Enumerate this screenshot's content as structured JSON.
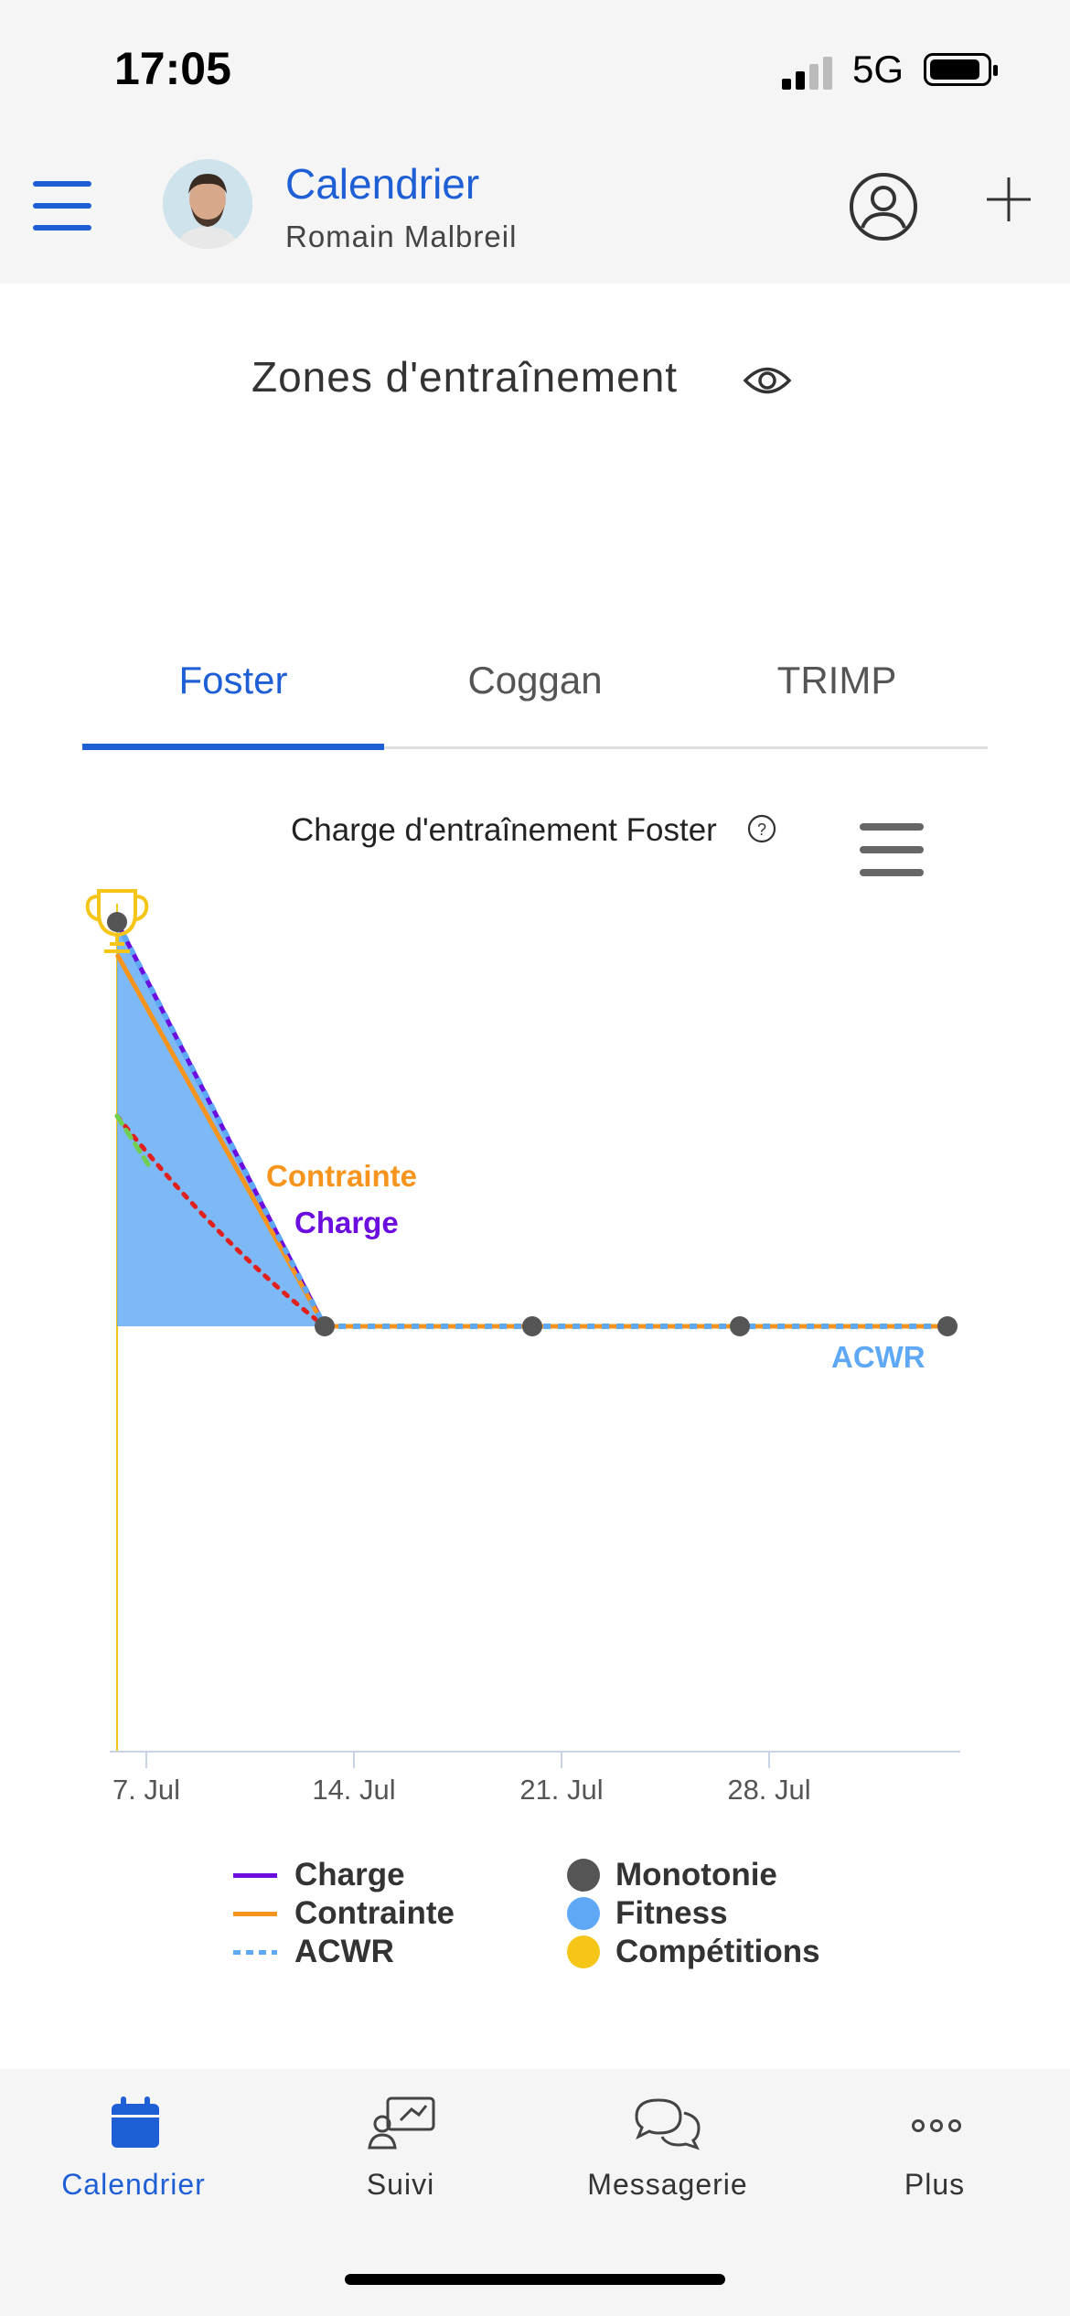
{
  "status": {
    "time": "17:05",
    "network": "5G"
  },
  "header": {
    "title": "Calendrier",
    "subtitle": "Romain Malbreil"
  },
  "section": {
    "title": "Zones d'entraînement"
  },
  "tabs": [
    {
      "label": "Foster",
      "active": true
    },
    {
      "label": "Coggan",
      "active": false
    },
    {
      "label": "TRIMP",
      "active": false
    }
  ],
  "chart": {
    "title": "Charge d'entraînement Foster",
    "labels": {
      "contrainte": "Contrainte",
      "charge": "Charge",
      "acwr": "ACWR"
    },
    "legend": {
      "charge": "Charge",
      "contrainte": "Contrainte",
      "acwr": "ACWR",
      "monotonie": "Monotonie",
      "fitness": "Fitness",
      "competitions": "Compétitions"
    }
  },
  "chart_data": {
    "type": "line",
    "x_ticks": [
      "7. Jul",
      "14. Jul",
      "21. Jul",
      "28. Jul"
    ],
    "series": [
      {
        "name": "Charge",
        "color": "#6a0dde",
        "style": "solid",
        "points": [
          [
            0,
            1
          ],
          [
            1,
            0
          ],
          [
            2,
            0
          ],
          [
            3,
            0
          ],
          [
            4,
            0
          ]
        ]
      },
      {
        "name": "Contrainte",
        "color": "#f7941d",
        "style": "solid",
        "points": [
          [
            0,
            0.92
          ],
          [
            1,
            0
          ],
          [
            2,
            0
          ],
          [
            3,
            0
          ],
          [
            4,
            0
          ]
        ]
      },
      {
        "name": "ACWR",
        "color": "#5ea8f5",
        "style": "dotted",
        "points": [
          [
            0,
            1
          ],
          [
            1,
            0
          ],
          [
            2,
            0
          ],
          [
            3,
            0
          ],
          [
            4,
            0
          ]
        ]
      },
      {
        "name": "Monotonie",
        "color": "#555555",
        "style": "markers",
        "points": [
          [
            0,
            1
          ],
          [
            1,
            0
          ],
          [
            2,
            0
          ],
          [
            3,
            0
          ],
          [
            4,
            0
          ]
        ]
      },
      {
        "name": "Fitness",
        "color": "#5ea8f5",
        "style": "area",
        "points": [
          [
            0,
            1
          ],
          [
            1,
            0
          ]
        ]
      },
      {
        "name": "Compétitions",
        "color": "#f5c518",
        "style": "trophy",
        "points": [
          [
            0,
            1
          ]
        ]
      }
    ],
    "other_lines": [
      {
        "color": "#e0201c",
        "style": "dotted",
        "points": [
          [
            0,
            0.52
          ],
          [
            0.5,
            0.2
          ],
          [
            1,
            0
          ],
          [
            4,
            0
          ]
        ]
      },
      {
        "color": "#6fcf50",
        "style": "dashed",
        "points": [
          [
            0,
            0.52
          ],
          [
            0.15,
            0.4
          ]
        ]
      }
    ],
    "colors": {
      "primary": "#1f5fd6",
      "charge": "#6a0dde",
      "contrainte": "#f7941d",
      "acwr": "#5ea8f5",
      "monotonie": "#555555",
      "fitness": "#5ea8f5",
      "competitions": "#f5c518"
    }
  },
  "nav": [
    {
      "label": "Calendrier",
      "icon": "calendar-icon",
      "active": true
    },
    {
      "label": "Suivi",
      "icon": "tracking-icon",
      "active": false
    },
    {
      "label": "Messagerie",
      "icon": "chat-icon",
      "active": false
    },
    {
      "label": "Plus",
      "icon": "more-icon",
      "active": false
    }
  ]
}
